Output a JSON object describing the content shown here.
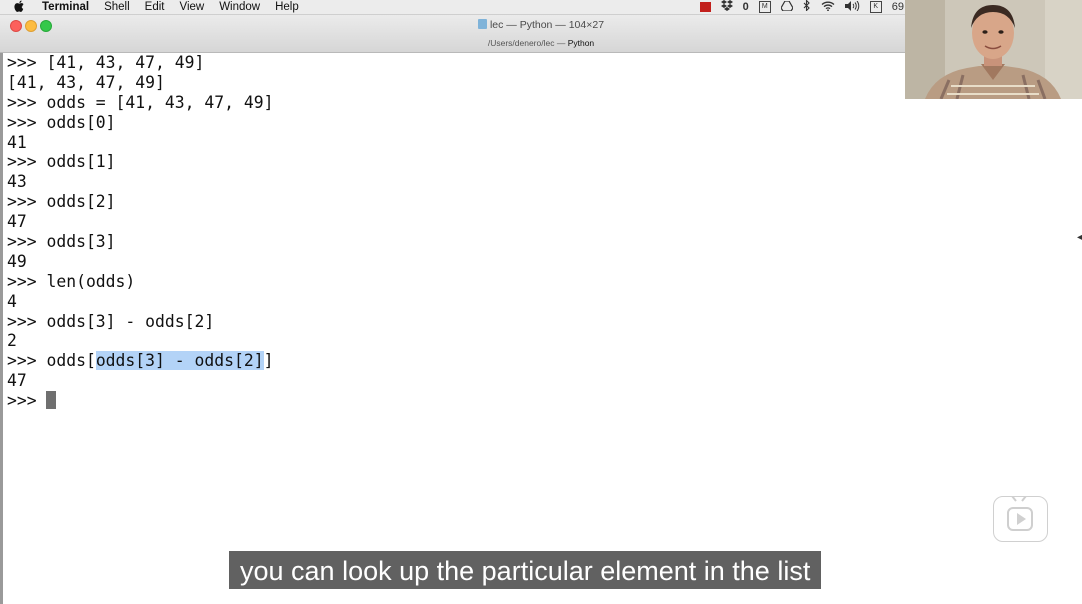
{
  "menubar": {
    "apple_glyph": "",
    "app_name": "Terminal",
    "items": [
      "Shell",
      "Edit",
      "View",
      "Window",
      "Help"
    ],
    "status_icons": [
      "record-indicator",
      "dropbox-icon",
      "zero-icon",
      "window-icon",
      "drive-icon",
      "bluetooth-icon",
      "wifi-icon",
      "volume-icon",
      "input-icon"
    ],
    "status_trailing_text": "69"
  },
  "window": {
    "title": "lec — Python — 104×27",
    "path_prefix": "/Users/denero/lec — ",
    "path_process": "Python"
  },
  "terminal": {
    "lines": [
      {
        "text": ">>> [41, 43, 47, 49]"
      },
      {
        "text": "[41, 43, 47, 49]"
      },
      {
        "text": ">>> odds = [41, 43, 47, 49]"
      },
      {
        "text": ">>> odds[0]"
      },
      {
        "text": "41"
      },
      {
        "text": ">>> odds[1]"
      },
      {
        "text": "43"
      },
      {
        "text": ">>> odds[2]"
      },
      {
        "text": "47"
      },
      {
        "text": ">>> odds[3]"
      },
      {
        "text": "49"
      },
      {
        "text": ">>> len(odds)"
      },
      {
        "text": "4"
      },
      {
        "text": ">>> odds[3] - odds[2]"
      },
      {
        "text": "2"
      },
      {
        "pre": ">>> odds[",
        "highlight": "odds[3] - odds[2]",
        "post": "]"
      },
      {
        "text": "47"
      }
    ],
    "prompt": ">>> "
  },
  "subtitle": "you can look up the particular element in the list",
  "colors": {
    "selection": "#b3d3f7",
    "subtitle_bg": "#4b4b4b",
    "cursor": "#6f6f6f"
  }
}
